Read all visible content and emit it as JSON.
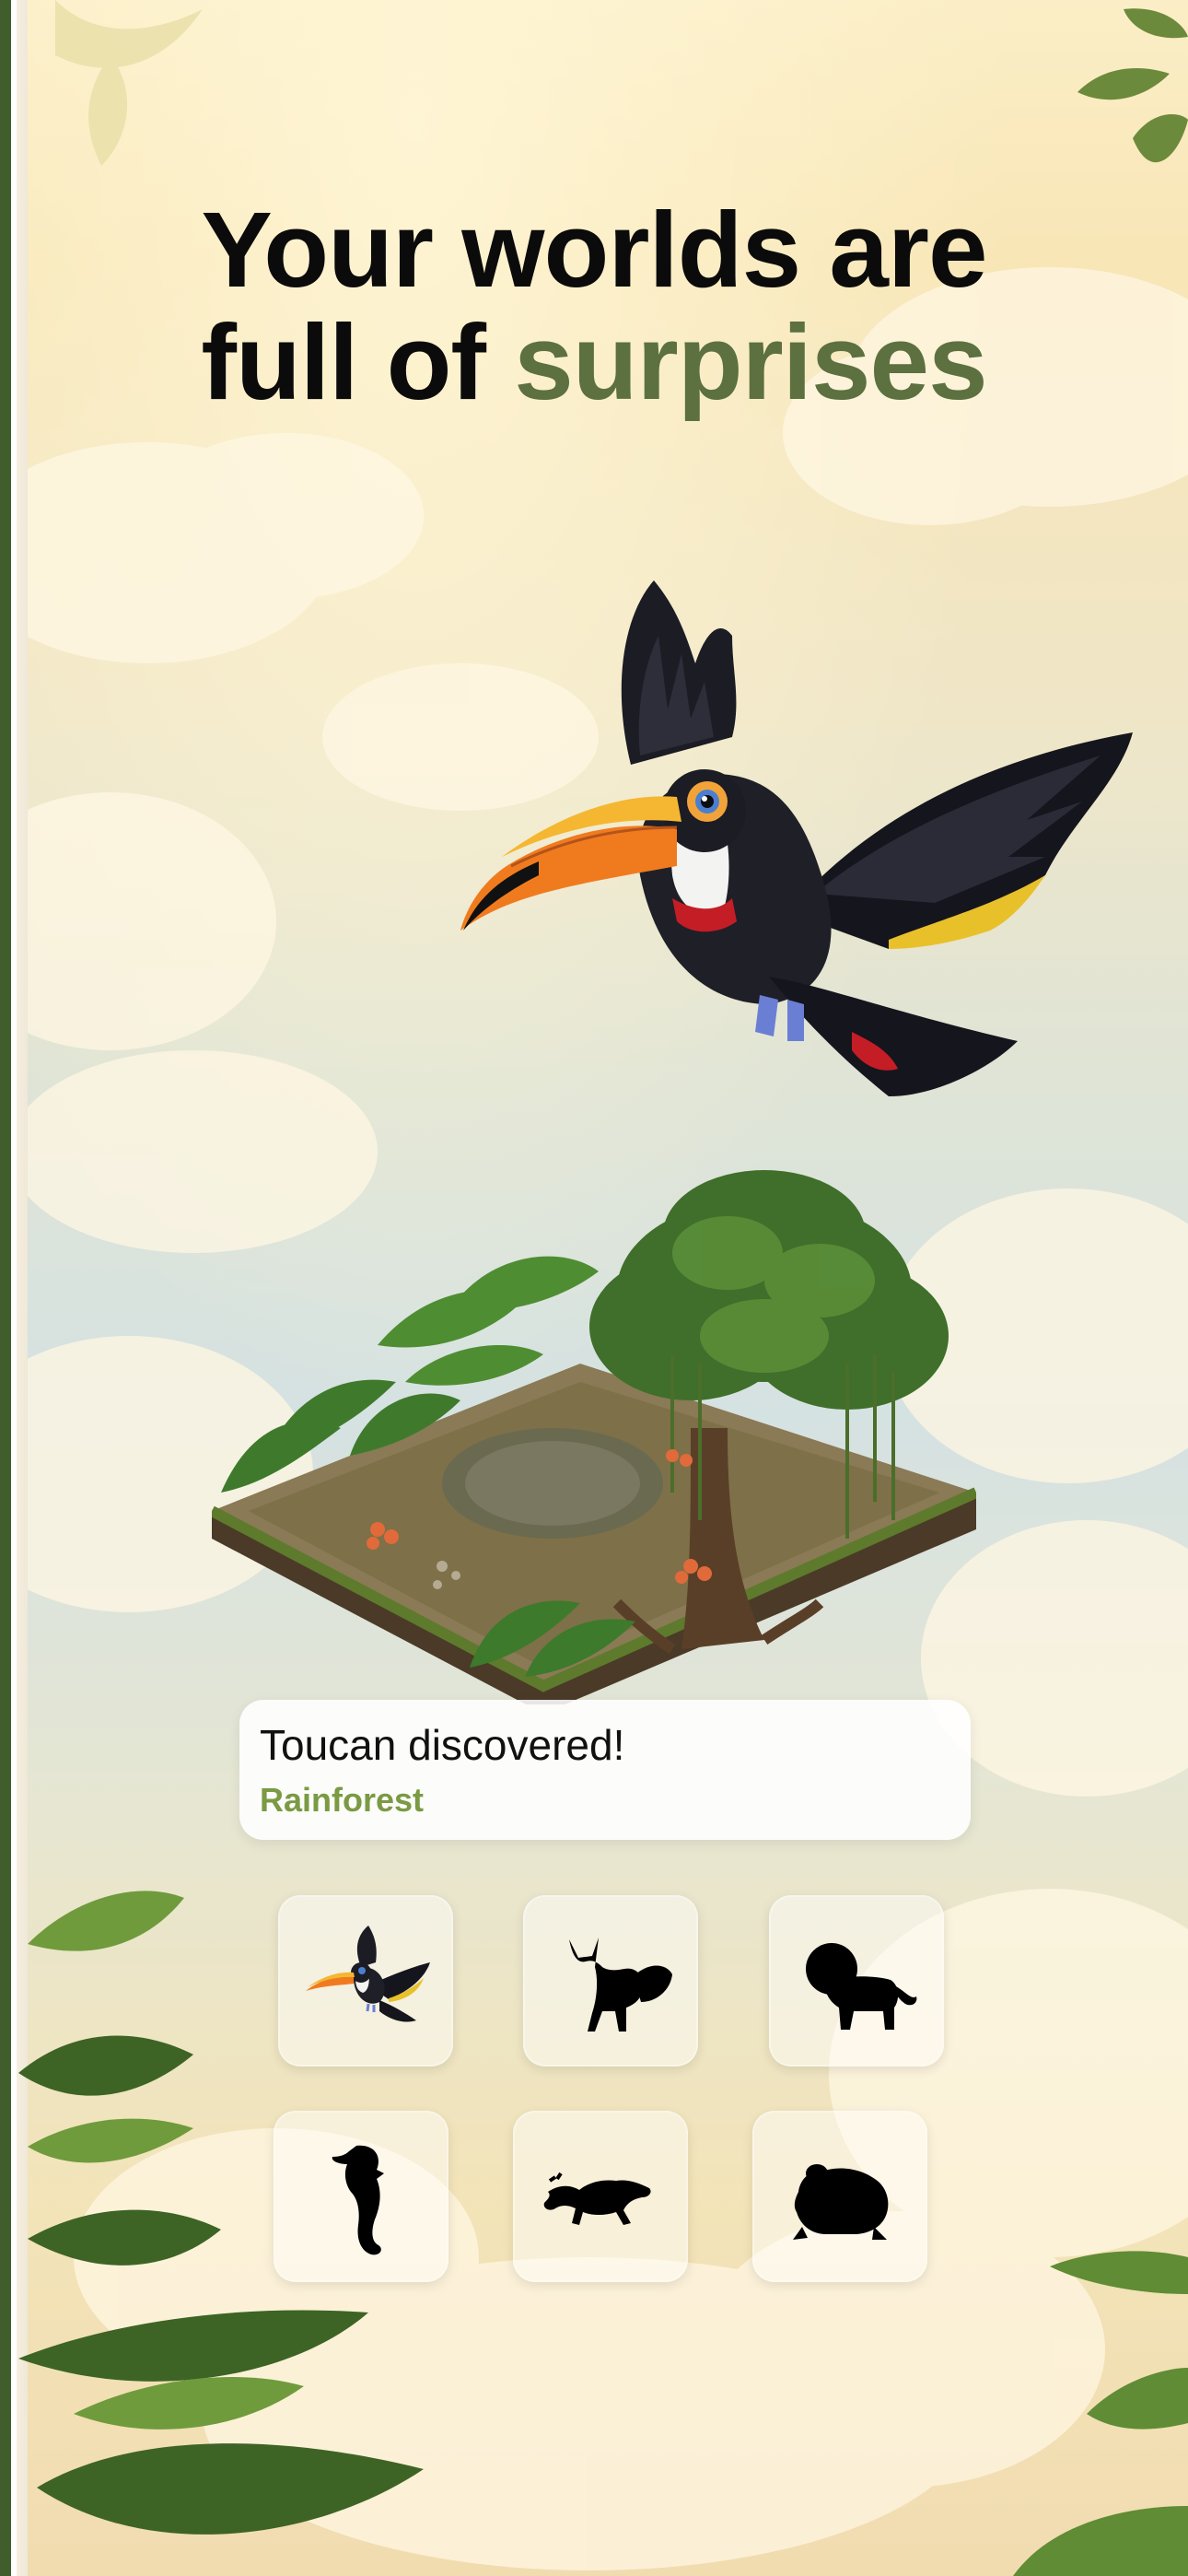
{
  "headline": {
    "line1": "Your worlds are",
    "line2_plain": "full of ",
    "line2_accent": "surprises"
  },
  "colors": {
    "accent_green": "#5c7040",
    "subtitle_green": "#7a9a43",
    "headline_text": "#0b0b0b"
  },
  "hero": {
    "bird": "toucan-icon",
    "habitat": "rainforest-island"
  },
  "toast": {
    "title": "Toucan discovered!",
    "subtitle": "Rainforest"
  },
  "collection": [
    {
      "icon": "toucan-icon",
      "state": "discovered"
    },
    {
      "icon": "fox-silhouette-icon",
      "state": "locked"
    },
    {
      "icon": "lion-silhouette-icon",
      "state": "locked"
    },
    {
      "icon": "seahorse-silhouette-icon",
      "state": "locked"
    },
    {
      "icon": "lizard-silhouette-icon",
      "state": "locked"
    },
    {
      "icon": "frog-silhouette-icon",
      "state": "locked"
    }
  ]
}
